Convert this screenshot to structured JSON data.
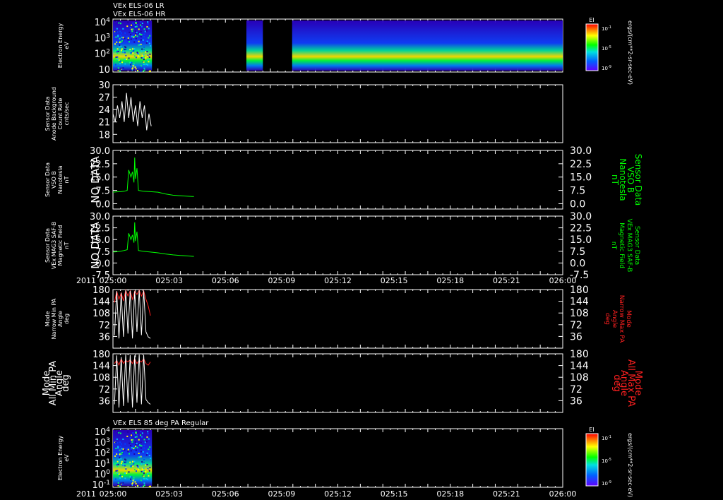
{
  "header": {
    "line1": "VEx ELS-06 LR",
    "line2": "VEx ELS-06 HR"
  },
  "year_label": "2011",
  "time_ticks": [
    "025:00",
    "025:03",
    "025:06",
    "025:09",
    "025:12",
    "025:15",
    "025:18",
    "025:21",
    "026:00"
  ],
  "chart_data": [
    {
      "id": "p1",
      "type": "heatmap",
      "ylabel": [
        "Electron Energy",
        "eV"
      ],
      "yscale": "log",
      "yticks": [
        "10^4",
        "10^3",
        "10^2",
        "10"
      ],
      "colorbar": {
        "title": "EI",
        "ticks": [
          "10^-1",
          "10^-5",
          "10^-9"
        ]
      },
      "side_label": "ergs/(cm**2-sr-sec-eV)",
      "segments": [
        {
          "from": "025:00",
          "to": "025:05.2",
          "band": "10 - 10^2 eV, peak ~30 eV"
        },
        {
          "from": "025:17.8",
          "to": "025:20.0",
          "band": "10 - 10^2 eV"
        },
        {
          "from": "025:23.9",
          "to": "026:00",
          "band": "10 - 10^2 eV"
        }
      ]
    },
    {
      "id": "p2",
      "type": "line",
      "ylabel": [
        "Sensor Data",
        "Anode Background",
        "Count Rate",
        "cnts/sec"
      ],
      "yticks": [
        "30",
        "27",
        "24",
        "21",
        "18"
      ],
      "ylim": [
        16,
        30
      ],
      "color": "#ffffff",
      "x": [
        0.0,
        0.3,
        0.6,
        0.9,
        1.2,
        1.5,
        1.8,
        2.1,
        2.4,
        2.7,
        3.0,
        3.3,
        3.6,
        3.9,
        4.2,
        4.5,
        4.8,
        5.1
      ],
      "y": [
        23,
        21,
        25,
        22,
        26,
        21,
        28,
        22,
        27,
        21,
        25,
        20,
        26,
        22,
        25,
        19,
        23,
        20
      ]
    },
    {
      "id": "p3",
      "type": "line",
      "left_label": "NO DATA",
      "ylabel": [
        "Sensor Data",
        "VSO B",
        "Nanotesla",
        "nT"
      ],
      "yticks": [
        "30.0",
        "22.5",
        "15.0",
        "7.5",
        "0.0"
      ],
      "ylim": [
        -3,
        30
      ],
      "color": "#00ff00",
      "x": [
        0.0,
        0.5,
        1.0,
        1.5,
        1.9,
        2.1,
        2.4,
        2.6,
        2.8,
        2.9,
        3.0,
        3.2,
        3.4,
        4.0,
        5.0,
        6.0,
        7.0,
        8.0,
        9.0,
        10.0,
        10.8
      ],
      "y": [
        6.5,
        6.7,
        6.8,
        7.0,
        7.5,
        19,
        15,
        18,
        12,
        26,
        14,
        20,
        7.5,
        7.0,
        6.8,
        6.5,
        5.5,
        4.8,
        4.5,
        4.2,
        4.0
      ]
    },
    {
      "id": "p4",
      "type": "line",
      "left_label": "NO DATA",
      "ylabel": [
        "Sensor Data",
        "VEx MAG3 SAF-B",
        "Magnetic Field",
        "nT"
      ],
      "yticks": [
        "30.0",
        "22.5",
        "15.0",
        "7.5",
        "0.0",
        "-7.5"
      ],
      "ylim": [
        -7.5,
        30
      ],
      "color": "#00ff00",
      "x": [
        0.0,
        0.5,
        1.0,
        1.5,
        1.9,
        2.1,
        2.4,
        2.6,
        2.8,
        2.9,
        3.0,
        3.2,
        3.4,
        4.0,
        5.0,
        6.0,
        7.0,
        8.0,
        9.0,
        10.0,
        10.8
      ],
      "y": [
        7,
        7.2,
        7.5,
        8,
        8.5,
        19,
        15,
        18,
        13,
        26,
        14,
        20,
        8,
        7.5,
        7,
        6.5,
        5.8,
        5.2,
        4.8,
        4.5,
        4.2
      ]
    },
    {
      "id": "p5",
      "type": "line",
      "ylabel": [
        "Mode",
        "Narrow Min PA",
        "Angle",
        "deg"
      ],
      "right_label": [
        "Mode",
        "Narrow Max PA",
        "Angle",
        "deg"
      ],
      "yticks": [
        "180",
        "144",
        "108",
        "72",
        "36"
      ],
      "ylim": [
        0,
        180
      ],
      "series": [
        {
          "color": "#ff2020",
          "x": [
            0.2,
            0.5,
            0.8,
            1.1,
            1.4,
            1.7,
            2.0,
            2.3,
            2.6,
            2.9,
            3.2,
            3.5,
            3.8,
            4.1,
            4.4,
            4.7,
            5.0
          ],
          "y": [
            140,
            175,
            150,
            170,
            145,
            178,
            160,
            176,
            150,
            175,
            165,
            178,
            160,
            176,
            150,
            130,
            100
          ]
        },
        {
          "color": "#ffffff",
          "x": [
            0.2,
            0.5,
            0.8,
            1.1,
            1.4,
            1.7,
            2.0,
            2.3,
            2.6,
            2.9,
            3.2,
            3.5,
            3.8,
            4.1,
            4.4,
            4.7,
            5.0
          ],
          "y": [
            40,
            175,
            30,
            170,
            35,
            178,
            45,
            176,
            30,
            175,
            50,
            178,
            40,
            176,
            50,
            35,
            30
          ]
        }
      ]
    },
    {
      "id": "p6",
      "type": "line",
      "ylabel": [
        "Mode",
        "All Min PA",
        "Angle",
        "deg"
      ],
      "right_label": [
        "Mode",
        "All Max PA",
        "Angle",
        "deg"
      ],
      "yticks": [
        "180",
        "144",
        "108",
        "72",
        "36"
      ],
      "ylim": [
        0,
        180
      ],
      "series": [
        {
          "color": "#ff2020",
          "x": [
            0.2,
            0.5,
            0.8,
            1.1,
            1.4,
            1.7,
            2.0,
            2.3,
            2.6,
            2.9,
            3.2,
            3.5,
            3.8,
            4.1,
            4.4,
            4.7,
            5.0
          ],
          "y": [
            150,
            160,
            145,
            165,
            150,
            160,
            155,
            162,
            150,
            165,
            150,
            160,
            155,
            165,
            150,
            145,
            155
          ]
        },
        {
          "color": "#ffffff",
          "x": [
            0.2,
            0.5,
            0.8,
            1.1,
            1.4,
            1.7,
            2.0,
            2.3,
            2.6,
            2.9,
            3.2,
            3.5,
            3.8,
            4.1,
            4.4,
            4.7,
            5.0
          ],
          "y": [
            25,
            175,
            15,
            170,
            20,
            178,
            30,
            176,
            15,
            175,
            30,
            178,
            25,
            176,
            40,
            30,
            25
          ]
        }
      ]
    },
    {
      "id": "p7",
      "type": "heatmap",
      "title": "VEx ELS 85 deg PA Regular",
      "ylabel": [
        "Electron Energy",
        "eV"
      ],
      "yscale": "log",
      "yticks": [
        "10^4",
        "10^3",
        "10^2",
        "10^1",
        "10^0",
        "10^-1"
      ],
      "colorbar": {
        "title": "EI",
        "ticks": [
          "10^-1",
          "10^-5",
          "10^-9"
        ]
      },
      "side_label": "ergs/(cm**2-sr-sec-eV)",
      "segments": [
        {
          "from": "025:00",
          "to": "025:05.2",
          "band": "10^0 - 10^2 eV"
        }
      ]
    }
  ]
}
